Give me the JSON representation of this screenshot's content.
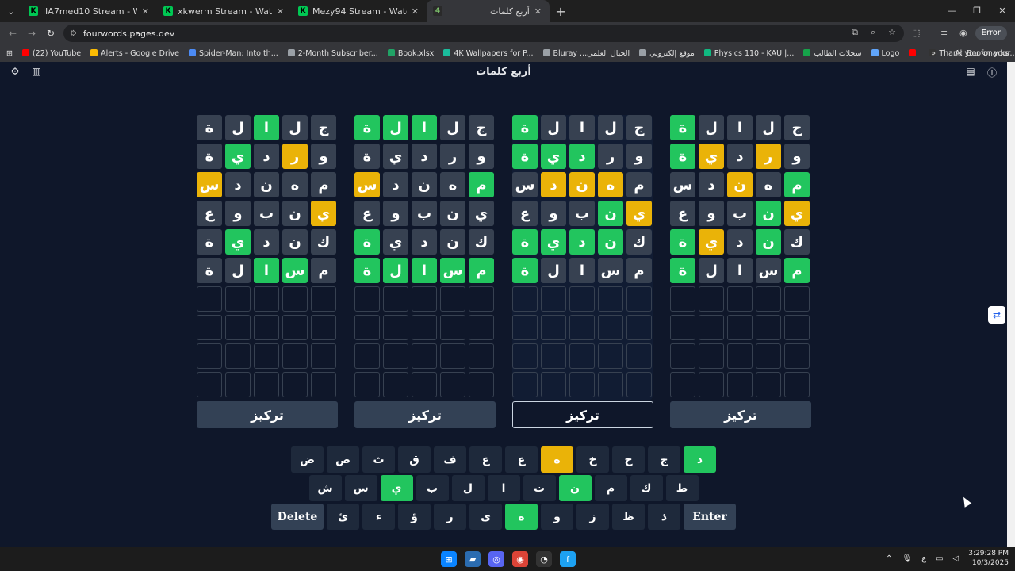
{
  "browser": {
    "tabs": [
      {
        "title": "lIA7med10 Stream - Watch Live",
        "fav": "K"
      },
      {
        "title": "xkwerm Stream - Watch Live on",
        "fav": "K"
      },
      {
        "title": "Mezy94 Stream - Watch Live on",
        "fav": "K"
      },
      {
        "title": "أربع كلمات",
        "fav": "4"
      }
    ],
    "new_tab": "+",
    "url": "fourwords.pages.dev",
    "error_label": "Error",
    "bookmarks": [
      {
        "label": "(22) YouTube",
        "color": "#ff0000"
      },
      {
        "label": "Alerts - Google Drive",
        "color": "#fbbc04"
      },
      {
        "label": "Spider-Man: Into th...",
        "color": "#4c8bf5"
      },
      {
        "label": "2-Month Subscriber...",
        "color": "#9aa0a6"
      },
      {
        "label": "Book.xlsx",
        "color": "#21a366"
      },
      {
        "label": "4K Wallpapers for P...",
        "color": "#1abc9c"
      },
      {
        "label": "Bluray ...الخيال العلمي",
        "color": "#9aa0a6"
      },
      {
        "label": "موقع إلكتروني",
        "color": "#9aa0a6"
      },
      {
        "label": "Physics 110 - KAU |...",
        "color": "#10b981"
      },
      {
        "label": "سجلات الطالب",
        "color": "#16a34a"
      },
      {
        "label": "Logo",
        "color": "#60a5fa"
      },
      {
        "label": "",
        "color": "#ff0000"
      },
      {
        "label": "Thank you for your...",
        "color": "#333"
      }
    ],
    "all_bookmarks": "All Bookmarks"
  },
  "app": {
    "title": "أربع كلمات",
    "focus_label": "تركيز"
  },
  "boards": [
    {
      "rows": [
        [
          [
            "ة",
            "n"
          ],
          [
            "ل",
            "n"
          ],
          [
            "ا",
            "g"
          ],
          [
            "ل",
            "n"
          ],
          [
            "ج",
            "n"
          ]
        ],
        [
          [
            "ة",
            "n"
          ],
          [
            "ي",
            "g"
          ],
          [
            "د",
            "n"
          ],
          [
            "ر",
            "y"
          ],
          [
            "و",
            "n"
          ]
        ],
        [
          [
            "س",
            "y"
          ],
          [
            "د",
            "n"
          ],
          [
            "ن",
            "n"
          ],
          [
            "ه",
            "n"
          ],
          [
            "م",
            "n"
          ]
        ],
        [
          [
            "ع",
            "n"
          ],
          [
            "و",
            "n"
          ],
          [
            "ب",
            "n"
          ],
          [
            "ن",
            "n"
          ],
          [
            "ي",
            "y"
          ]
        ],
        [
          [
            "ة",
            "n"
          ],
          [
            "ي",
            "g"
          ],
          [
            "د",
            "n"
          ],
          [
            "ن",
            "n"
          ],
          [
            "ك",
            "n"
          ]
        ],
        [
          [
            "ة",
            "n"
          ],
          [
            "ل",
            "n"
          ],
          [
            "ا",
            "g"
          ],
          [
            "س",
            "g"
          ],
          [
            "م",
            "n"
          ]
        ]
      ]
    },
    {
      "rows": [
        [
          [
            "ة",
            "g"
          ],
          [
            "ل",
            "g"
          ],
          [
            "ا",
            "g"
          ],
          [
            "ل",
            "n"
          ],
          [
            "ج",
            "n"
          ]
        ],
        [
          [
            "ة",
            "n"
          ],
          [
            "ي",
            "n"
          ],
          [
            "د",
            "n"
          ],
          [
            "ر",
            "n"
          ],
          [
            "و",
            "n"
          ]
        ],
        [
          [
            "س",
            "y"
          ],
          [
            "د",
            "n"
          ],
          [
            "ن",
            "n"
          ],
          [
            "ه",
            "n"
          ],
          [
            "م",
            "g"
          ]
        ],
        [
          [
            "ع",
            "n"
          ],
          [
            "و",
            "n"
          ],
          [
            "ب",
            "n"
          ],
          [
            "ن",
            "n"
          ],
          [
            "ي",
            "n"
          ]
        ],
        [
          [
            "ة",
            "g"
          ],
          [
            "ي",
            "n"
          ],
          [
            "د",
            "n"
          ],
          [
            "ن",
            "n"
          ],
          [
            "ك",
            "n"
          ]
        ],
        [
          [
            "ة",
            "g"
          ],
          [
            "ل",
            "g"
          ],
          [
            "ا",
            "g"
          ],
          [
            "س",
            "g"
          ],
          [
            "م",
            "g"
          ]
        ]
      ]
    },
    {
      "rows": [
        [
          [
            "ة",
            "g"
          ],
          [
            "ل",
            "n"
          ],
          [
            "ا",
            "n"
          ],
          [
            "ل",
            "n"
          ],
          [
            "ج",
            "n"
          ]
        ],
        [
          [
            "ة",
            "g"
          ],
          [
            "ي",
            "g"
          ],
          [
            "د",
            "g"
          ],
          [
            "ر",
            "n"
          ],
          [
            "و",
            "n"
          ]
        ],
        [
          [
            "س",
            "n"
          ],
          [
            "د",
            "y"
          ],
          [
            "ن",
            "y"
          ],
          [
            "ه",
            "y"
          ],
          [
            "م",
            "n"
          ]
        ],
        [
          [
            "ع",
            "n"
          ],
          [
            "و",
            "n"
          ],
          [
            "ب",
            "n"
          ],
          [
            "ن",
            "g"
          ],
          [
            "ي",
            "y"
          ]
        ],
        [
          [
            "ة",
            "g"
          ],
          [
            "ي",
            "g"
          ],
          [
            "د",
            "g"
          ],
          [
            "ن",
            "g"
          ],
          [
            "ك",
            "n"
          ]
        ],
        [
          [
            "ة",
            "g"
          ],
          [
            "ل",
            "n"
          ],
          [
            "ا",
            "n"
          ],
          [
            "س",
            "n"
          ],
          [
            "م",
            "n"
          ]
        ]
      ]
    },
    {
      "rows": [
        [
          [
            "ة",
            "g"
          ],
          [
            "ل",
            "n"
          ],
          [
            "ا",
            "n"
          ],
          [
            "ل",
            "n"
          ],
          [
            "ج",
            "n"
          ]
        ],
        [
          [
            "ة",
            "g"
          ],
          [
            "ي",
            "y"
          ],
          [
            "د",
            "n"
          ],
          [
            "ر",
            "y"
          ],
          [
            "و",
            "n"
          ]
        ],
        [
          [
            "س",
            "n"
          ],
          [
            "د",
            "n"
          ],
          [
            "ن",
            "y"
          ],
          [
            "ه",
            "n"
          ],
          [
            "م",
            "g"
          ]
        ],
        [
          [
            "ع",
            "n"
          ],
          [
            "و",
            "n"
          ],
          [
            "ب",
            "n"
          ],
          [
            "ن",
            "g"
          ],
          [
            "ي",
            "y"
          ]
        ],
        [
          [
            "ة",
            "g"
          ],
          [
            "ي",
            "y"
          ],
          [
            "د",
            "n"
          ],
          [
            "ن",
            "g"
          ],
          [
            "ك",
            "n"
          ]
        ],
        [
          [
            "ة",
            "g"
          ],
          [
            "ل",
            "n"
          ],
          [
            "ا",
            "n"
          ],
          [
            "س",
            "n"
          ],
          [
            "م",
            "g"
          ]
        ]
      ]
    }
  ],
  "keyboard": {
    "row1": [
      [
        "ض",
        "n"
      ],
      [
        "ص",
        "n"
      ],
      [
        "ث",
        "n"
      ],
      [
        "ق",
        "n"
      ],
      [
        "ف",
        "n"
      ],
      [
        "غ",
        "n"
      ],
      [
        "ع",
        "n"
      ],
      [
        "ه",
        "y"
      ],
      [
        "خ",
        "n"
      ],
      [
        "ح",
        "n"
      ],
      [
        "ج",
        "n"
      ],
      [
        "د",
        "g"
      ]
    ],
    "row2": [
      [
        "ش",
        "n"
      ],
      [
        "س",
        "n"
      ],
      [
        "ي",
        "g"
      ],
      [
        "ب",
        "n"
      ],
      [
        "ل",
        "n"
      ],
      [
        "ا",
        "n"
      ],
      [
        "ت",
        "n"
      ],
      [
        "ن",
        "g"
      ],
      [
        "م",
        "n"
      ],
      [
        "ك",
        "n"
      ],
      [
        "ط",
        "n"
      ]
    ],
    "row3": [
      [
        "Delete",
        "w"
      ],
      [
        "ئ",
        "n"
      ],
      [
        "ء",
        "n"
      ],
      [
        "ؤ",
        "n"
      ],
      [
        "ر",
        "n"
      ],
      [
        "ى",
        "n"
      ],
      [
        "ة",
        "g"
      ],
      [
        "و",
        "n"
      ],
      [
        "ز",
        "n"
      ],
      [
        "ظ",
        "n"
      ],
      [
        "ذ",
        "n"
      ],
      [
        "Enter",
        "w"
      ]
    ]
  },
  "colors": {
    "green": "#22c55e",
    "yellow": "#eab308",
    "gray": "#374151",
    "background": "#0f172a"
  },
  "system": {
    "time": "3:29:28 PM",
    "date": "10/3/2025",
    "lang": "ع"
  }
}
